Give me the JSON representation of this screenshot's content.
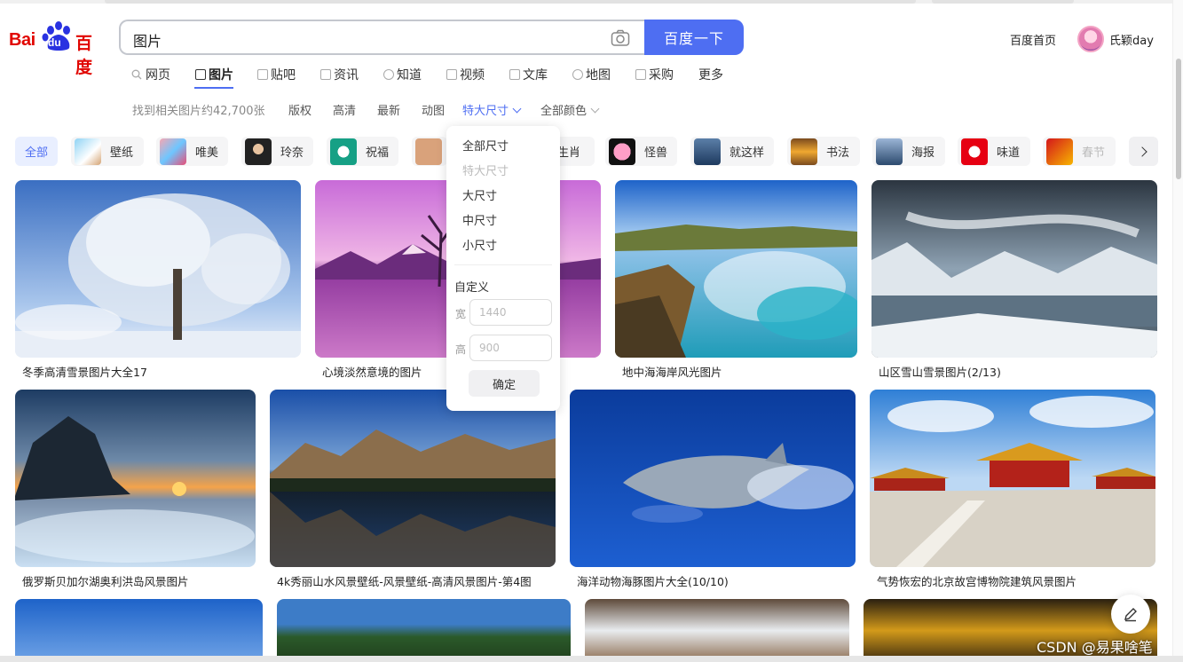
{
  "header": {
    "logo_text_en": "Bai",
    "logo_text_du": "du",
    "logo_text_cn": "百度",
    "search_query": "图片",
    "search_button": "百度一下",
    "home_link": "百度首页",
    "username": "氏颖day"
  },
  "nav": {
    "items": [
      {
        "label": "网页",
        "icon": "search-icon"
      },
      {
        "label": "图片",
        "icon": "image-icon"
      },
      {
        "label": "贴吧",
        "icon": "tieba-icon"
      },
      {
        "label": "资讯",
        "icon": "news-icon"
      },
      {
        "label": "知道",
        "icon": "question-icon"
      },
      {
        "label": "视频",
        "icon": "video-icon"
      },
      {
        "label": "文库",
        "icon": "doc-icon"
      },
      {
        "label": "地图",
        "icon": "map-icon"
      },
      {
        "label": "采购",
        "icon": "cart-icon"
      },
      {
        "label": "更多",
        "icon": ""
      }
    ],
    "active_index": 1
  },
  "filters": {
    "result_count": "找到相关图片约42,700张",
    "copyright": "版权",
    "hd": "高清",
    "latest": "最新",
    "animated": "动图",
    "size": "特大尺寸",
    "color": "全部颜色"
  },
  "chips": [
    "全部",
    "壁纸",
    "唯美",
    "玲奈",
    "祝福",
    "",
    "生肖",
    "怪兽",
    "就这样",
    "书法",
    "海报",
    "味道",
    "春节"
  ],
  "images": [
    {
      "caption": "冬季高清雪景图片大全17"
    },
    {
      "caption": "心境淡然意境的图片"
    },
    {
      "caption": "地中海海岸风光图片"
    },
    {
      "caption": "山区雪山雪景图片(2/13)"
    },
    {
      "caption": "俄罗斯贝加尔湖奥利洪岛风景图片"
    },
    {
      "caption": "4k秀丽山水风景壁纸-风景壁纸-高清风景图片-第4图"
    },
    {
      "caption": "海洋动物海豚图片大全(10/10)"
    },
    {
      "caption": "气势恢宏的北京故宫博物院建筑风景图片"
    }
  ],
  "dropdown": {
    "options": [
      "全部尺寸",
      "特大尺寸",
      "大尺寸",
      "中尺寸",
      "小尺寸"
    ],
    "selected": "特大尺寸",
    "custom_label": "自定义",
    "width_label": "宽",
    "width_placeholder": "1440",
    "height_label": "高",
    "height_placeholder": "900",
    "confirm": "确定"
  },
  "watermark": "CSDN @易果啥笔",
  "colors": {
    "accent": "#4e6ef2",
    "brand_red": "#e10601"
  }
}
